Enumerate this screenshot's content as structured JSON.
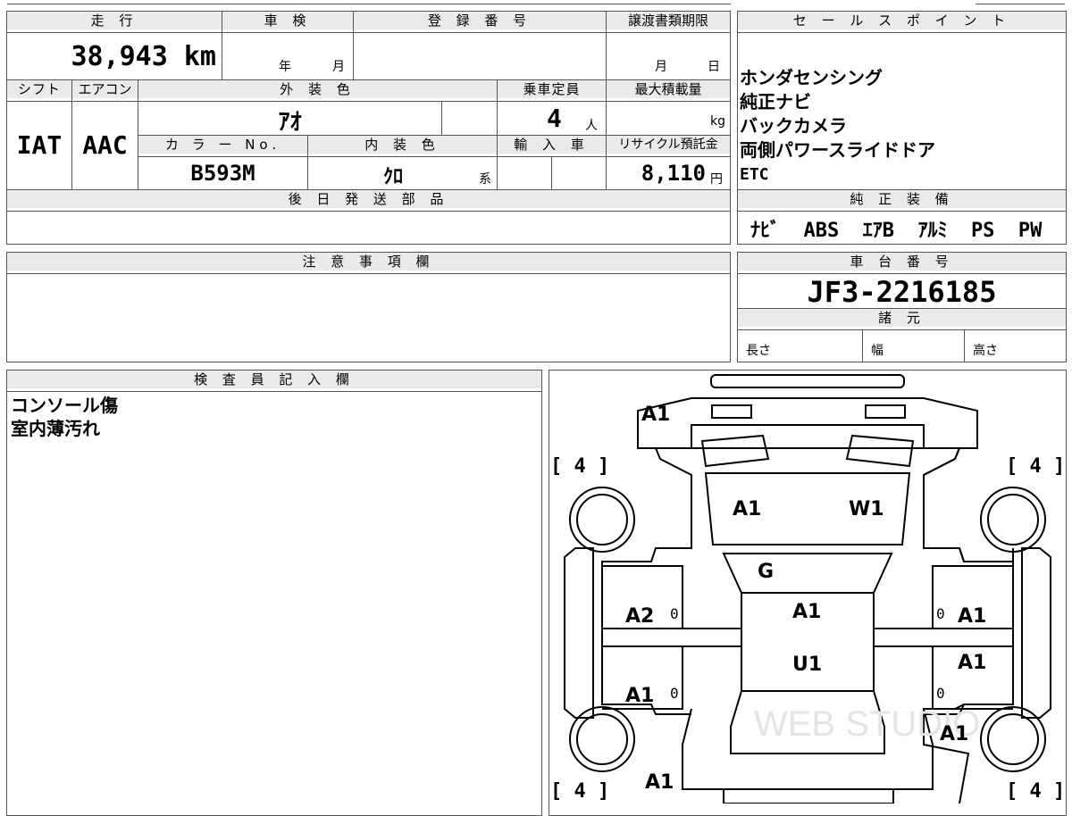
{
  "top_table": {
    "mileage_header": "走 行",
    "shaken_header": "車 検",
    "registration_header": "登 録 番 号",
    "transfer_deadline_header": "譲渡書類期限",
    "mileage_value": "38,943 km",
    "shaken_year": "年",
    "shaken_month": "月",
    "transfer_month": "月",
    "transfer_day": "日",
    "shift_header": "シフト",
    "aircon_header": "エアコン",
    "exterior_color_header": "外 装 色",
    "capacity_header": "乗車定員",
    "max_load_header": "最大積載量",
    "shift_value": "IAT",
    "aircon_value": "AAC",
    "exterior_color_value": "ｱｵ",
    "capacity_value": "4",
    "capacity_unit": "人",
    "max_load_unit": "kg",
    "color_no_header": "カ ラ ー No.",
    "interior_color_header": "内 装 色",
    "import_header": "輸 入 車",
    "recycle_header": "リサイクル預託金",
    "color_no_value": "B593M",
    "interior_color_value": "ｸﾛ",
    "interior_color_suffix": "系",
    "recycle_value": "8,110",
    "recycle_unit": "円",
    "later_parts_header": "後 日 発 送 部 品"
  },
  "sales_points": {
    "header": "セ ー ル ス ポ イ ン ト",
    "items": [
      "ホンダセンシング",
      "純正ナビ",
      "バックカメラ",
      "両側パワースライドドア",
      "ETC"
    ]
  },
  "genuine_equipment": {
    "header": "純 正 装 備",
    "value": "ﾅﾋﾞ  ABS  ｴｱB  ｱﾙﾐ  PS  PW"
  },
  "notes": {
    "header": "注 意 事 項 欄"
  },
  "chassis": {
    "header": "車 台 番 号",
    "value": "JF3-2216185"
  },
  "specs": {
    "header": "諸 元",
    "length": "長さ",
    "width": "幅",
    "height": "高さ"
  },
  "inspector": {
    "header": "検 査 員 記 入 欄",
    "lines": [
      "コンソール傷",
      "室内薄汚れ"
    ]
  },
  "diagram": {
    "labels": {
      "front_bumper": "A1",
      "hood_left": "A1",
      "hood_right": "W1",
      "windshield": "G",
      "roof": "A1",
      "roof_lower": "U1",
      "left_front_door": "A2",
      "left_rear_door": "A1",
      "right_front_door": "A1",
      "right_rear_door": "A1",
      "right_quarter": "A1",
      "rear": "A1"
    },
    "zero": "0",
    "tires": {
      "front_left": "[ 4 ]",
      "front_right": "[ 4 ]",
      "rear_left": "[ 4 ]",
      "rear_right": "[ 4 ]"
    },
    "watermark": "WEB STUDIO"
  }
}
